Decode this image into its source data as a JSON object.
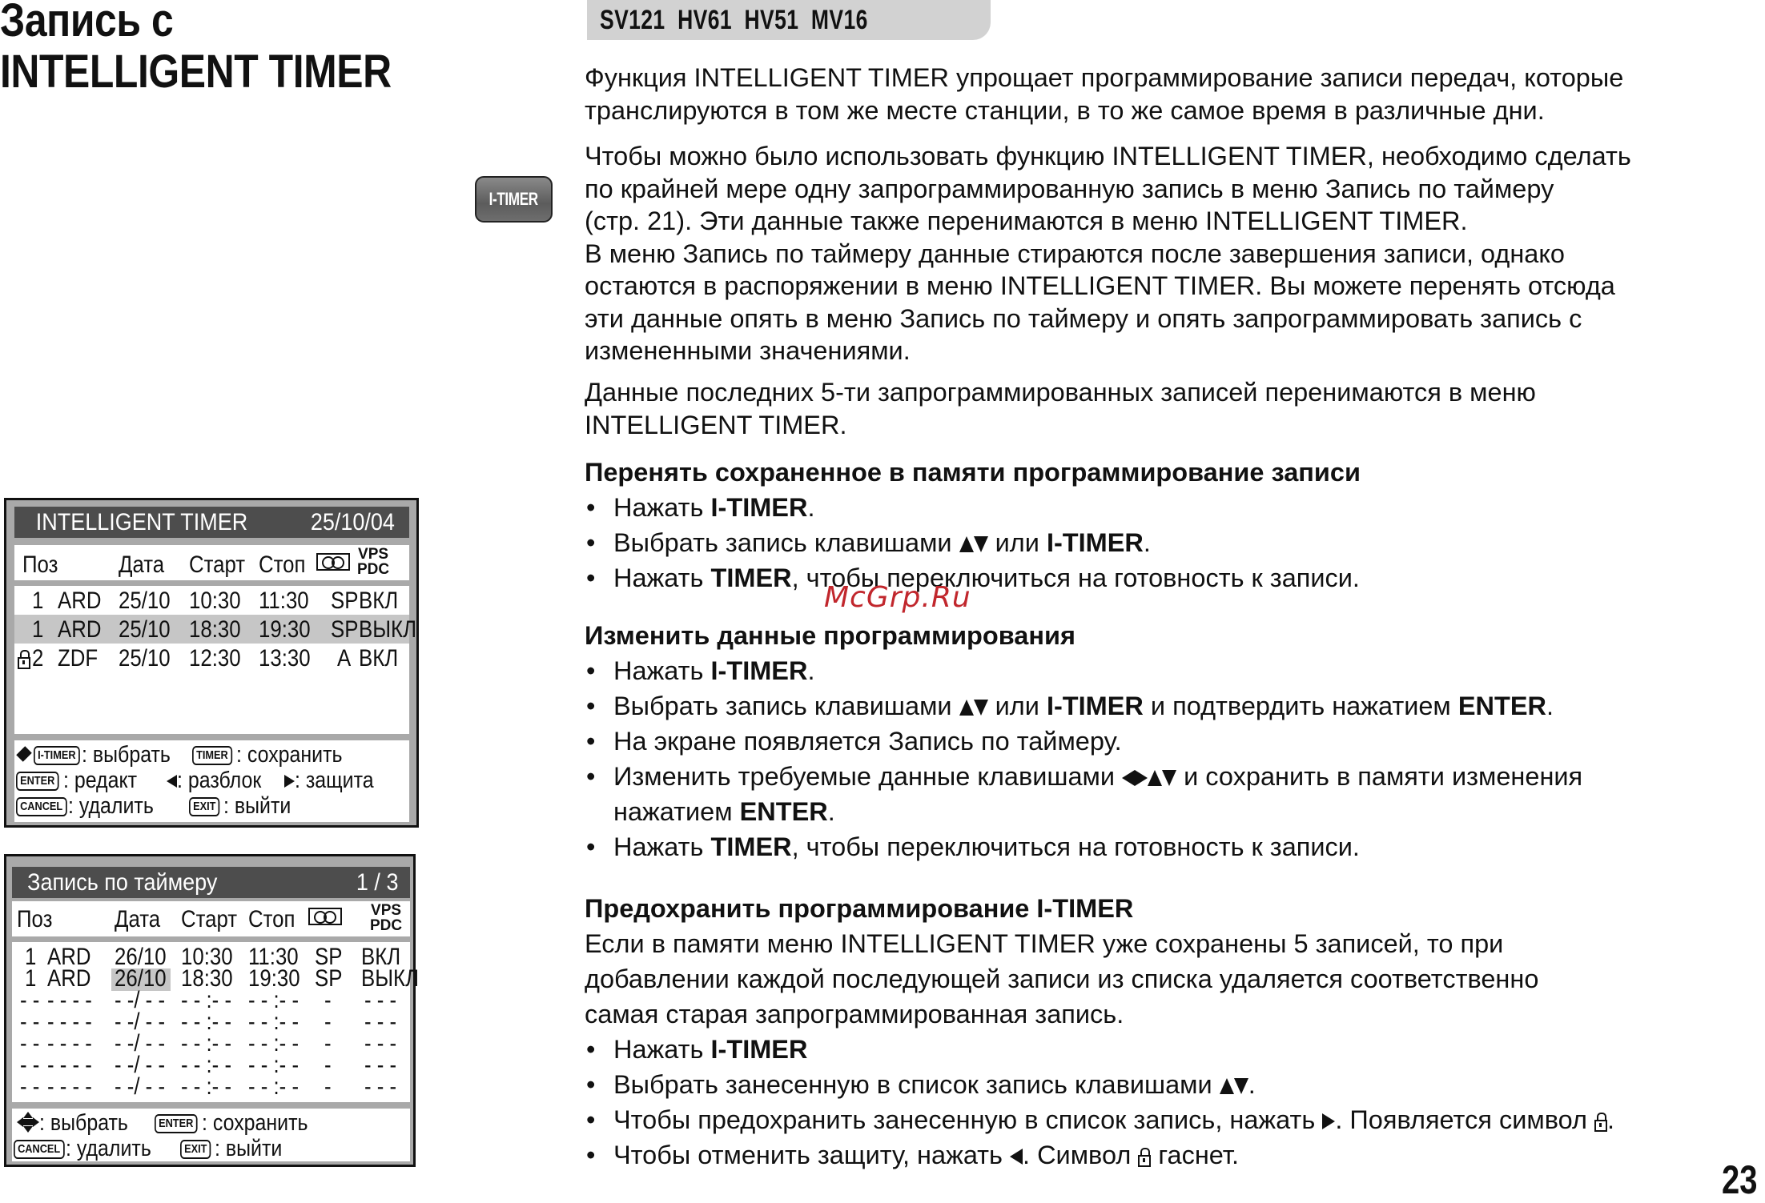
{
  "page": {
    "title_line1": "Запись с",
    "title_line2": "INTELLIGENT TIMER",
    "model_tag": "SV121  HV61  HV51  MV16",
    "page_number": "23",
    "watermark": "McGrp.Ru"
  },
  "itimer_button": {
    "label": "I-TIMER",
    "icon": "itimer-remote-button-icon"
  },
  "intro": {
    "p1": "Функция INTELLIGENT TIMER упрощает программирование записи передач, которые транслируются в том же месте станции, в то же самое время в различные дни.",
    "p2_lines": [
      "Чтобы можно было использовать функцию INTELLIGENT TIMER, необходимо сделать",
      "по крайней мере одну запрограммированную запись в меню Запись по таймеру",
      "(стр. 21). Эти данные также перенимаются в меню INTELLIGENT TIMER.",
      "В меню Запись по таймеру данные стираются после завершения записи, однако",
      "остаются в распоряжении в меню INTELLIGENT TIMER. Вы можете перенять отсюда",
      "эти данные опять в меню Запись по таймеру и опять запрограммировать запись с",
      "измененными значениями."
    ],
    "p3": "Данные последних 5-ти запрограммированных записей перенимаются в меню INTELLIGENT TIMER."
  },
  "section_copy": {
    "heading": "Перенять сохраненное в памяти программирование записи",
    "b1_pre": "Нажать ",
    "b1_bold": "I-TIMER",
    "b1_post": ".",
    "b2_pre": "Выбрать запись клавишами ",
    "b2_mid": " или ",
    "b2_bold": "I-TIMER",
    "b2_post": ".",
    "b3_pre": "Нажать ",
    "b3_bold": "TIMER",
    "b3_post": ", чтобы переключиться на готовность к записи."
  },
  "section_edit": {
    "heading": "Изменить данные программирования",
    "b1_pre": "Нажать ",
    "b1_bold": "I-TIMER",
    "b1_post": ".",
    "b2_pre": "Выбрать запись клавишами ",
    "b2_mid": " или ",
    "b2_bold": "I-TIMER",
    "b2_mid2": " и подтвердить нажатием ",
    "b2_bold2": "ENTER",
    "b2_post": ".",
    "b3": "На экране появляется Запись по таймеру.",
    "b4_pre": "Изменить требуемые данные клавишами ",
    "b4_mid": " и сохранить в памяти изменения",
    "b4_line2_pre": "нажатием ",
    "b4_bold": "ENTER",
    "b4_post": ".",
    "b5_pre": "Нажать ",
    "b5_bold": "TIMER",
    "b5_post": ", чтобы переключиться на готовность к записи."
  },
  "section_protect": {
    "heading": "Предохранить программирование I-TIMER",
    "text_lines": [
      "Если в памяти меню INTELLIGENT TIMER уже сохранены 5 записей, то при",
      "добавлении каждой последующей записи из списка удаляется соответственно",
      "самая старая запрограммированная запись."
    ],
    "b1_pre": "Нажать ",
    "b1_bold": "I-TIMER",
    "b2_pre": "Выбрать занесенную в список запись клавишами ",
    "b2_post": ".",
    "b3_pre": "Чтобы предохранить  занесенную в список запись, нажать ",
    "b3_mid": ". Появляется символ ",
    "b3_post": ".",
    "b4_pre": "Чтобы отменить защиту, нажать ",
    "b4_mid": ". Символ ",
    "b4_post": " гаснет."
  },
  "osd_intelligent": {
    "title": "INTELLIGENT TIMER",
    "date": "25/10/04",
    "headers": {
      "pos": "Поз",
      "date": "Дата",
      "start": "Старт",
      "stop": "Стоп",
      "tape_icon": "cassette-icon",
      "vps1": "VPS",
      "vps2": "PDC"
    },
    "rows": [
      {
        "locked": false,
        "highlight": false,
        "pos": "1",
        "station": "ARD",
        "date": "25/10",
        "start": "10:30",
        "stop": "11:30",
        "speed": "SP",
        "vps": "ВКЛ"
      },
      {
        "locked": false,
        "highlight": true,
        "pos": "1",
        "station": "ARD",
        "date": "25/10",
        "start": "18:30",
        "stop": "19:30",
        "speed": "SP",
        "vps": "ВЫКЛ"
      },
      {
        "locked": true,
        "highlight": false,
        "pos": "2",
        "station": "ZDF",
        "date": "25/10",
        "start": "12:30",
        "stop": "13:30",
        "speed": "A",
        "vps": "ВКЛ"
      }
    ],
    "legend": {
      "k_itimer": "I-TIMER",
      "t_select": ": выбрать",
      "k_timer": "TIMER",
      "t_save": ": сохранить",
      "k_enter": "ENTER",
      "t_edit": ": редакт",
      "t_unlock": ": разблок",
      "t_protect": ": защита",
      "k_cancel": "CANCEL",
      "t_delete": ": удалить",
      "k_exit": "EXIT",
      "t_exit": ": выйти"
    }
  },
  "osd_timer": {
    "title": "Запись по таймеру",
    "page": "1 / 3",
    "headers": {
      "pos": "Поз",
      "date": "Дата",
      "start": "Старт",
      "stop": "Стоп",
      "tape_icon": "cassette-icon",
      "vps1": "VPS",
      "vps2": "PDC"
    },
    "rows": [
      {
        "pos": "1",
        "station": "ARD",
        "date": "26/10",
        "start": "10:30",
        "stop": "11:30",
        "speed": "SP",
        "vps": "ВКЛ"
      },
      {
        "pos": "1",
        "station": "ARD",
        "date": "26/10",
        "start": "18:30",
        "stop": "19:30",
        "speed": "SP",
        "vps": "ВЫКЛ",
        "date_highlight": true
      },
      {
        "pos": "--",
        "station": "----",
        "date": "--/--",
        "start": "--:--",
        "stop": "--:--",
        "speed": "-",
        "vps": "---"
      },
      {
        "pos": "--",
        "station": "----",
        "date": "--/--",
        "start": "--:--",
        "stop": "--:--",
        "speed": "-",
        "vps": "---"
      },
      {
        "pos": "--",
        "station": "----",
        "date": "--/--",
        "start": "--:--",
        "stop": "--:--",
        "speed": "-",
        "vps": "---"
      },
      {
        "pos": "--",
        "station": "----",
        "date": "--/--",
        "start": "--:--",
        "stop": "--:--",
        "speed": "-",
        "vps": "---"
      },
      {
        "pos": "--",
        "station": "----",
        "date": "--/--",
        "start": "--:--",
        "stop": "--:--",
        "speed": "-",
        "vps": "---"
      }
    ],
    "legend": {
      "t_select": ": выбрать",
      "k_enter": "ENTER",
      "t_save": ": сохранить",
      "k_cancel": "CANCEL",
      "t_delete": ": удалить",
      "k_exit": "EXIT",
      "t_exit": ": выйти"
    }
  }
}
